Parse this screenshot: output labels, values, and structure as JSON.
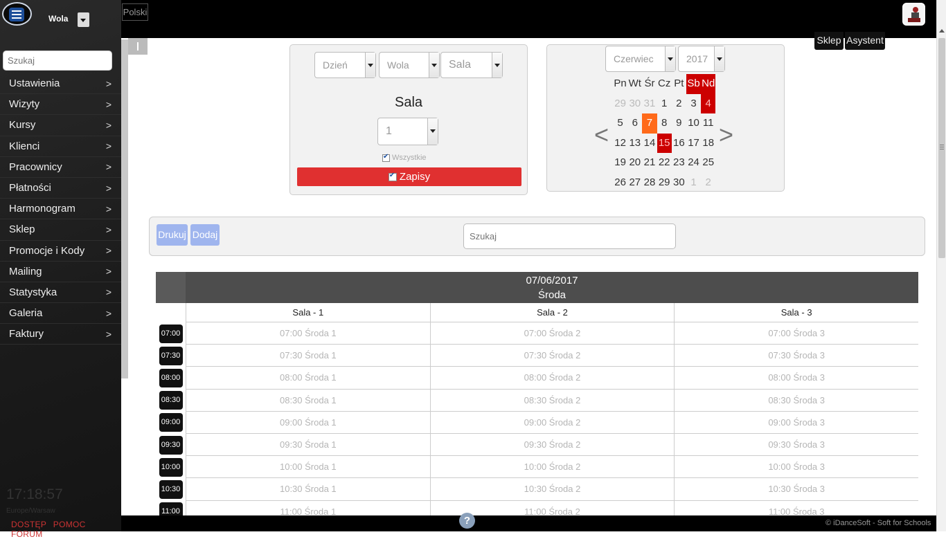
{
  "header": {
    "language": "Polski",
    "school_name": "Wola"
  },
  "sidebar": {
    "search_placeholder": "Szukaj",
    "items": [
      {
        "label": "Ustawienia"
      },
      {
        "label": "Wizyty"
      },
      {
        "label": "Kursy"
      },
      {
        "label": "Klienci"
      },
      {
        "label": "Pracownicy"
      },
      {
        "label": "Płatności"
      },
      {
        "label": "Harmonogram"
      },
      {
        "label": "Sklep"
      },
      {
        "label": "Promocje i Kody"
      },
      {
        "label": "Mailing"
      },
      {
        "label": "Statystyka"
      },
      {
        "label": "Galeria"
      },
      {
        "label": "Faktury"
      }
    ],
    "arrow": ">",
    "clock": "17:18:57",
    "timezone": "Europe/Warsaw",
    "footer_links": [
      "DOSTĘP",
      "POMOC",
      "FORUM"
    ]
  },
  "top_buttons": {
    "shop": "Sklep",
    "assistant": "Asystent"
  },
  "filters": {
    "view_select": "Dzień",
    "school_select": "Wola",
    "type_select": "Sala",
    "title": "Sala",
    "number_select": "1",
    "all_label": "Wszystkie",
    "all_checked": true,
    "zapisy_label": "Zapisy",
    "zapisy_checked": true
  },
  "calendar": {
    "month": "Czerwiec",
    "year": "2017",
    "prev": "<",
    "next": ">",
    "weekdays": [
      "Pn",
      "Wt",
      "Śr",
      "Cz",
      "Pt",
      "Sb",
      "Nd"
    ],
    "weeks": [
      [
        "29",
        "30",
        "31",
        "1",
        "2",
        "3",
        "4"
      ],
      [
        "5",
        "6",
        "7",
        "8",
        "9",
        "10",
        "11"
      ],
      [
        "12",
        "13",
        "14",
        "15",
        "16",
        "17",
        "18"
      ],
      [
        "19",
        "20",
        "21",
        "22",
        "23",
        "24",
        "25"
      ],
      [
        "26",
        "27",
        "28",
        "29",
        "30",
        "1",
        "2"
      ]
    ],
    "today": "7",
    "highlighted": [
      "4",
      "15"
    ]
  },
  "toolbar": {
    "print": "Drukuj",
    "add": "Dodaj",
    "search_placeholder": "Szukaj"
  },
  "schedule": {
    "date": "07/06/2017",
    "day": "Środa",
    "columns": [
      "Sala - 1",
      "Sala - 2",
      "Sala - 3"
    ],
    "rows": [
      {
        "time": "07:00",
        "slots": [
          "07:00 Środa 1",
          "07:00 Środa 2",
          "07:00 Środa 3"
        ]
      },
      {
        "time": "07:30",
        "slots": [
          "07:30 Środa 1",
          "07:30 Środa 2",
          "07:30 Środa 3"
        ]
      },
      {
        "time": "08:00",
        "slots": [
          "08:00 Środa 1",
          "08:00 Środa 2",
          "08:00 Środa 3"
        ]
      },
      {
        "time": "08:30",
        "slots": [
          "08:30 Środa 1",
          "08:30 Środa 2",
          "08:30 Środa 3"
        ]
      },
      {
        "time": "09:00",
        "slots": [
          "09:00 Środa 1",
          "09:00 Środa 2",
          "09:00 Środa 3"
        ]
      },
      {
        "time": "09:30",
        "slots": [
          "09:30 Środa 1",
          "09:30 Środa 2",
          "09:30 Środa 3"
        ]
      },
      {
        "time": "10:00",
        "slots": [
          "10:00 Środa 1",
          "10:00 Środa 2",
          "10:00 Środa 3"
        ]
      },
      {
        "time": "10:30",
        "slots": [
          "10:30 Środa 1",
          "10:30 Środa 2",
          "10:30 Środa 3"
        ]
      },
      {
        "time": "11:00",
        "slots": [
          "11:00 Środa 1",
          "11:00 Środa 2",
          "11:00 Środa 3"
        ]
      }
    ]
  },
  "footer": {
    "help": "?",
    "copyright": "© iDanceSoft - Soft for Schools"
  }
}
